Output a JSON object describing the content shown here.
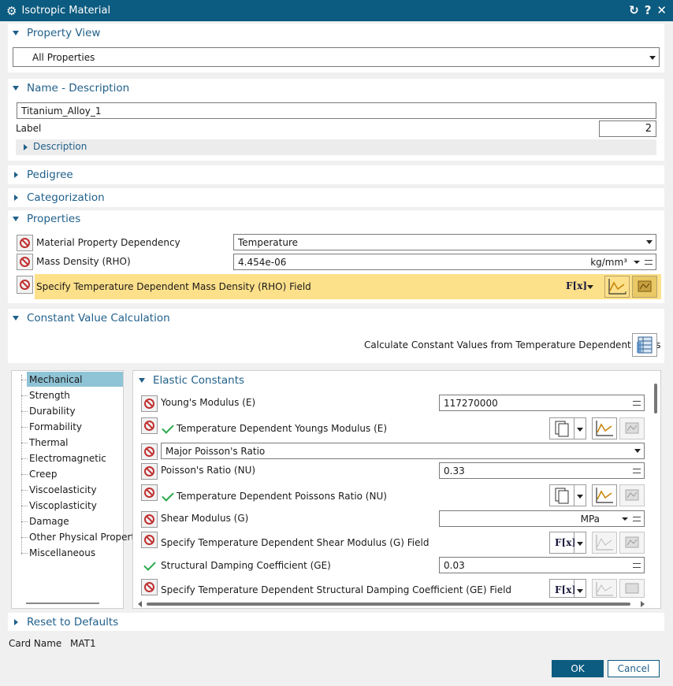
{
  "window": {
    "title": "Isotropic Material"
  },
  "property_view": {
    "header": "Property View",
    "value": "All Properties"
  },
  "name_desc": {
    "header": "Name - Description",
    "name": "Titanium_Alloy_1",
    "label_text": "Label",
    "label_value": "2",
    "description": "Description"
  },
  "sections": {
    "pedigree": "Pedigree",
    "categorization": "Categorization",
    "properties": "Properties",
    "constant": "Constant Value Calculation",
    "reset": "Reset to Defaults"
  },
  "properties": {
    "dependency_label": "Material Property Dependency",
    "dependency_value": "Temperature",
    "rho_label": "Mass Density (RHO)",
    "rho_value": "4.454e-06",
    "rho_unit": "kg/mm³",
    "rho_field_label": "Specify Temperature Dependent Mass Density (RHO) Field"
  },
  "constant_calc": {
    "label": "Calculate Constant Values from Temperature Dependent Fields"
  },
  "tree": [
    "Mechanical",
    "Strength",
    "Durability",
    "Formability",
    "Thermal",
    "Electromagnetic",
    "Creep",
    "Viscoelasticity",
    "Viscoplasticity",
    "Damage",
    "Other Physical Propert",
    "Miscellaneous"
  ],
  "elastic": {
    "header": "Elastic Constants",
    "E_label": "Young's Modulus (E)",
    "E_value": "117270000",
    "E_temp": "Temperature Dependent Youngs Modulus (E)",
    "poisson_select": "Major Poisson's Ratio",
    "NU_label": "Poisson's Ratio (NU)",
    "NU_value": "0.33",
    "NU_temp": "Temperature Dependent Poissons Ratio (NU)",
    "G_label": "Shear Modulus (G)",
    "G_unit": "MPa",
    "G_field": "Specify Temperature Dependent Shear Modulus (G) Field",
    "GE_label": "Structural Damping Coefficient (GE)",
    "GE_value": "0.03",
    "GE_field": "Specify Temperature Dependent Structural Damping Coefficient (GE) Field"
  },
  "footer": {
    "card_label": "Card Name",
    "card_value": "MAT1",
    "ok": "OK",
    "cancel": "Cancel"
  },
  "colors": {
    "titlebar": "#0c5b80",
    "highlight": "#fde08a",
    "selected": "#8fc3d6",
    "ok": "#0c5b80"
  }
}
